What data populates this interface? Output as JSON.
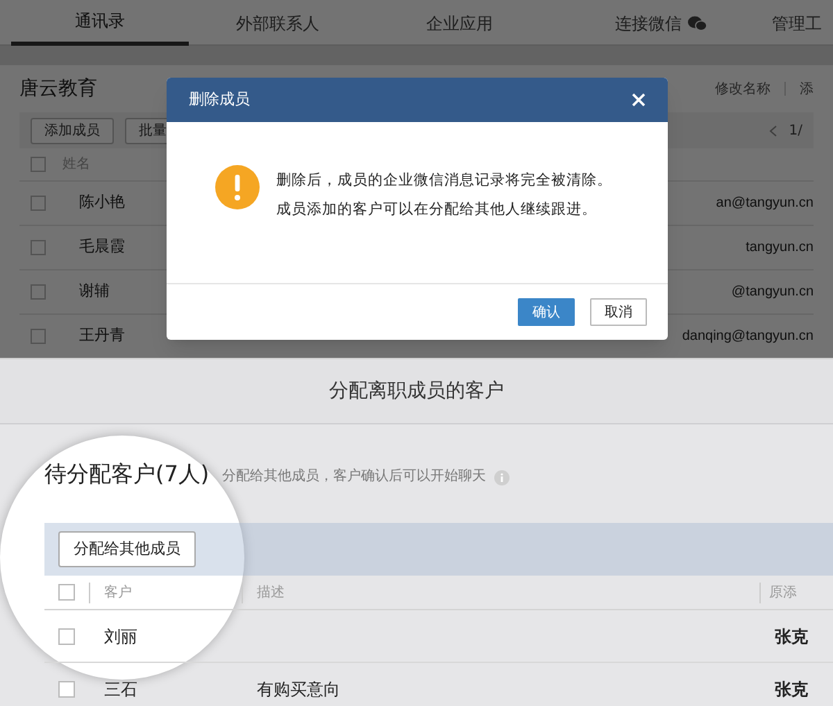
{
  "background_app": {
    "tabs": [
      {
        "label": "通讯录",
        "selected": true,
        "icon": false
      },
      {
        "label": "外部联系人",
        "selected": false,
        "icon": false
      },
      {
        "label": "企业应用",
        "selected": false,
        "icon": false
      },
      {
        "label": "连接微信",
        "selected": false,
        "icon": true
      },
      {
        "label": "管理工",
        "selected": false,
        "icon": false
      }
    ],
    "org_name": "唐云教育",
    "header_links": [
      "修改名称",
      "添"
    ],
    "toolbar_buttons": [
      "添加成员",
      "批量"
    ],
    "pagination": "1/",
    "table": {
      "columns": [
        "姓名"
      ],
      "all_checked": false,
      "rows": [
        {
          "name": "陈小艳",
          "email": "an@tangyun.cn",
          "checked": false
        },
        {
          "name": "毛晨霞",
          "email": "tangyun.cn",
          "checked": false
        },
        {
          "name": "谢辅",
          "email": "@tangyun.cn",
          "checked": false
        },
        {
          "name": "王丹青",
          "email": "danqing@tangyun.cn",
          "checked": false
        }
      ]
    }
  },
  "dialog": {
    "title": "删除成员",
    "message_lines": [
      "删除后，成员的企业微信消息记录将完全被清除。",
      "成员添加的客户可以在分配给其他人继续跟进。"
    ],
    "buttons": [
      {
        "label": "确认",
        "kind": "primary"
      },
      {
        "label": "取消",
        "kind": "secondary"
      }
    ]
  },
  "reassign_page": {
    "title": "分配离职成员的客户",
    "section_title": "待分配客户(7人)",
    "hint": "分配给其他成员，客户确认后可以开始聊天",
    "toolbar_button": "分配给其他成员",
    "table": {
      "columns": [
        "客户",
        "描述",
        "原添"
      ],
      "all_checked": false,
      "rows": [
        {
          "customer": "刘丽",
          "added_by": "张克",
          "checked": false
        },
        {
          "customer": "三石",
          "description": "有购买意向",
          "added_by": "张克",
          "checked": false
        }
      ]
    }
  }
}
